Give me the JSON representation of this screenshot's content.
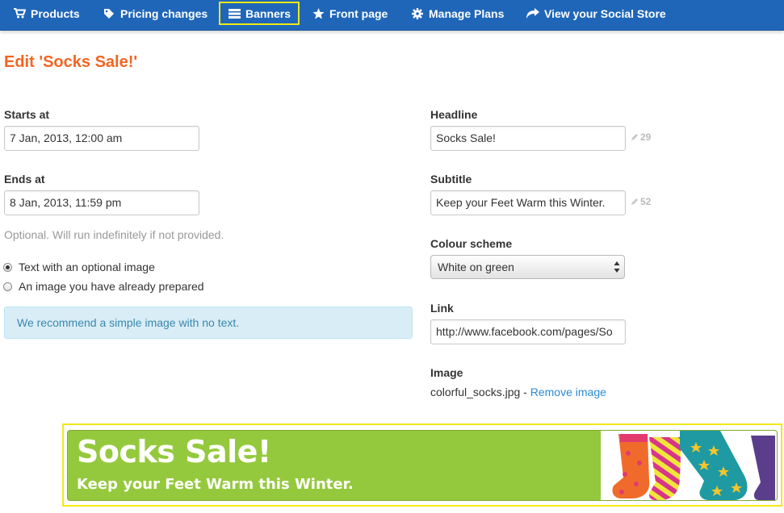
{
  "nav": {
    "items": [
      {
        "label": "Products",
        "icon": "cart-icon"
      },
      {
        "label": "Pricing changes",
        "icon": "tag-icon"
      },
      {
        "label": "Banners",
        "icon": "list-icon",
        "active": true
      },
      {
        "label": "Front page",
        "icon": "star-icon"
      },
      {
        "label": "Manage Plans",
        "icon": "gear-icon"
      },
      {
        "label": "View your Social Store",
        "icon": "share-arrow-icon"
      }
    ],
    "colors": {
      "background": "#1f66b8",
      "active_outline": "#f2e816"
    }
  },
  "page": {
    "title": "Edit 'Socks Sale!'",
    "title_color": "#f26522"
  },
  "form": {
    "starts_at": {
      "label": "Starts at",
      "value": "7 Jan, 2013, 12:00 am"
    },
    "ends_at": {
      "label": "Ends at",
      "value": "8 Jan, 2013, 11:59 pm"
    },
    "ends_help": "Optional. Will run indefinitely if not provided.",
    "banner_type": {
      "options": [
        {
          "label": "Text with an optional image",
          "checked": true
        },
        {
          "label": "An image you have already prepared",
          "checked": false
        }
      ]
    },
    "recommendation": "We recommend a simple image with no text.",
    "headline": {
      "label": "Headline",
      "value": "Socks Sale!",
      "chars_left": "29"
    },
    "subtitle": {
      "label": "Subtitle",
      "value": "Keep your Feet Warm this Winter.",
      "chars_left": "52"
    },
    "colour_scheme": {
      "label": "Colour scheme",
      "value": "White on green"
    },
    "link": {
      "label": "Link",
      "value": "http://www.facebook.com/pages/So"
    },
    "image": {
      "label": "Image",
      "filename": "colorful_socks.jpg",
      "separator": " - ",
      "remove_label": "Remove image"
    }
  },
  "preview": {
    "headline": "Socks Sale!",
    "subtitle": "Keep your Feet Warm this Winter.",
    "background": "#95c93d",
    "text_color": "#ffffff"
  }
}
